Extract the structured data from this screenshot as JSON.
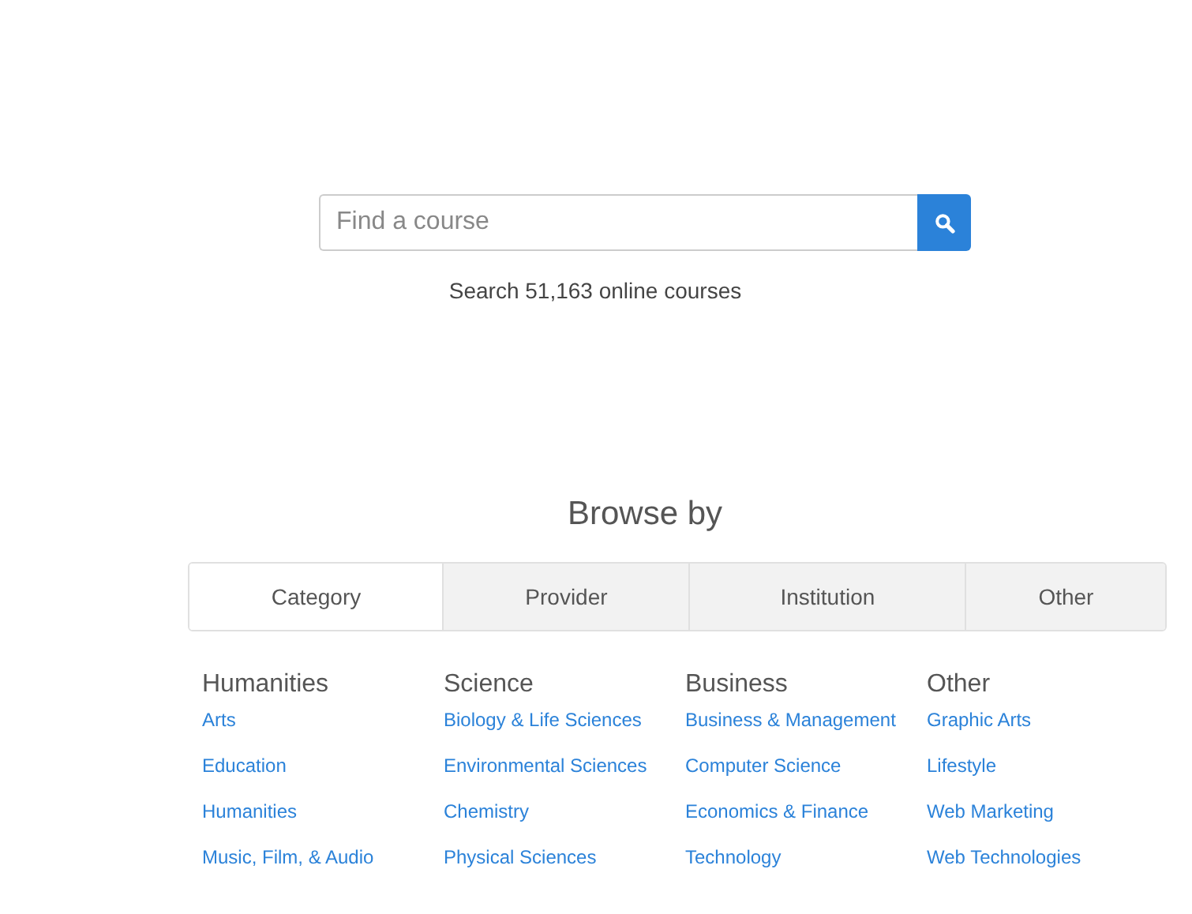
{
  "search": {
    "placeholder": "Find a course",
    "caption": "Search 51,163 online courses"
  },
  "browse": {
    "title": "Browse by",
    "tabs": [
      {
        "label": "Category",
        "selected": true
      },
      {
        "label": "Provider",
        "selected": false
      },
      {
        "label": "Institution",
        "selected": false
      },
      {
        "label": "Other",
        "selected": false
      }
    ],
    "columns": [
      {
        "heading": "Humanities",
        "links": [
          "Arts",
          "Education",
          "Humanities",
          "Music, Film, & Audio"
        ]
      },
      {
        "heading": "Science",
        "links": [
          "Biology & Life Sciences",
          "Environmental Sciences",
          "Chemistry",
          "Physical Sciences"
        ]
      },
      {
        "heading": "Business",
        "links": [
          "Business & Management",
          "Computer Science",
          "Economics & Finance",
          "Technology"
        ]
      },
      {
        "heading": "Other",
        "links": [
          "Graphic Arts",
          "Lifestyle",
          "Web Marketing",
          "Web Technologies"
        ]
      }
    ]
  }
}
